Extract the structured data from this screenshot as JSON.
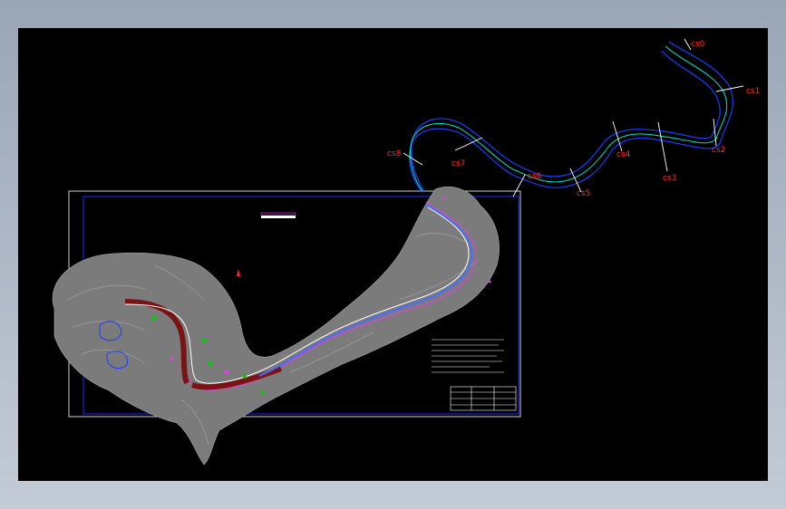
{
  "colors": {
    "background": "#000000",
    "frame": "#ffffff",
    "border_blue": "#1a2cff",
    "terrain": "#8a8a8a",
    "centerline": "#00e5c8",
    "bank": "#1a3cff",
    "channel": "#7a1414",
    "annotation": "#ff2a2a",
    "magenta": "#e040e0",
    "green": "#00d000"
  },
  "sections": [
    {
      "id": "cs0",
      "label": "cs0"
    },
    {
      "id": "cs1",
      "label": "cs1"
    },
    {
      "id": "cs2",
      "label": "cs2"
    },
    {
      "id": "cs3",
      "label": "cs3"
    },
    {
      "id": "cs4",
      "label": "cs4"
    },
    {
      "id": "cs5",
      "label": "cs5"
    },
    {
      "id": "cs6",
      "label": "cs6"
    },
    {
      "id": "cs7",
      "label": "cs7"
    },
    {
      "id": "cs8",
      "label": "cs8"
    }
  ]
}
